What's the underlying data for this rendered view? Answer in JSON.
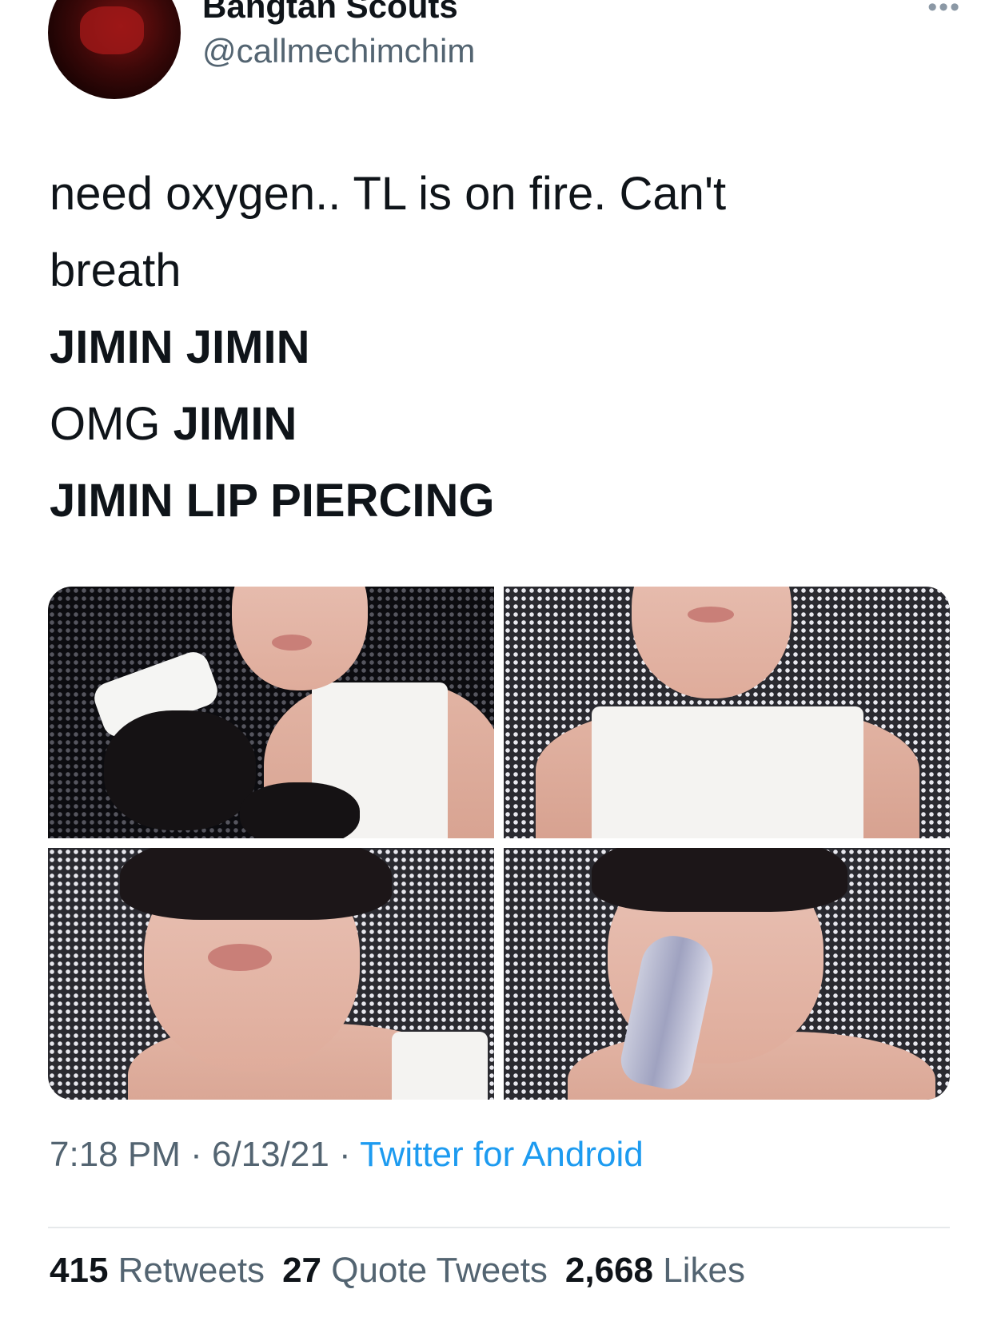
{
  "author": {
    "display_name": "Bangtan Scouts",
    "handle": "@callmechimchim"
  },
  "more_icon": "ellipsis-icon",
  "tweet": {
    "line1": "need oxygen.. TL is on fire. Can't",
    "line2": "breath",
    "line3": "JIMIN JIMIN",
    "line4_regular": "OMG ",
    "line4_bold": "JIMIN",
    "line5": "JIMIN LIP PIERCING"
  },
  "meta": {
    "time": "7:18 PM",
    "sep1": " · ",
    "date": "6/13/21",
    "sep2": " · ",
    "source": "Twitter for Android"
  },
  "stats": {
    "retweets_count": "415",
    "retweets_label": " Retweets",
    "quotes_count": "27",
    "quotes_label": " Quote Tweets",
    "likes_count": "2,668",
    "likes_label": " Likes"
  },
  "colors": {
    "text": "#0f1419",
    "secondary": "#536471",
    "link": "#1d9bf0",
    "divider": "#e6e9eb"
  }
}
